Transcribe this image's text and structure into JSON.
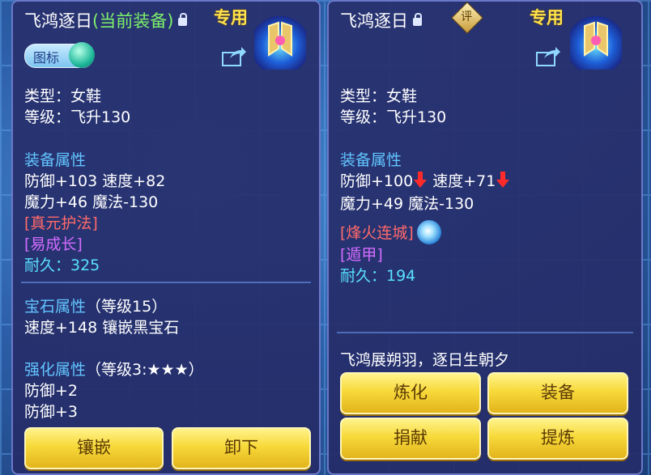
{
  "left": {
    "title": "飞鸿逐日",
    "title_current": "(当前装备)",
    "exclusive": "专用",
    "tag_label": "图标",
    "type": "类型：女鞋",
    "level": "等级：飞升130",
    "attr_header": "装备属性",
    "attr_line1": "防御+103 速度+82",
    "attr_line2": "魔力+46 魔法-130",
    "special": "[真元护法]",
    "effect": "[易成长]",
    "durability": "耐久：325",
    "gem_header": "宝石属性",
    "gem_level": "（等级15）",
    "gem_line": "速度+148 镶嵌黑宝石",
    "enhance_header": "强化属性",
    "enhance_level": "（等级3:★★★）",
    "enhance_line1": "防御+2",
    "enhance_line2": "防御+3",
    "btn_inlay": "镶嵌",
    "btn_unequip": "卸下"
  },
  "right": {
    "title": "飞鸿逐日",
    "rating_label": "评",
    "exclusive": "专用",
    "type": "类型：女鞋",
    "level": "等级：飞升130",
    "attr_header": "装备属性",
    "attr_def": "防御+100",
    "attr_spd": "速度+71",
    "attr_line2": "魔力+49 魔法-130",
    "special": "[烽火连城]",
    "effect": "[遁甲]",
    "durability": "耐久：194",
    "flavor": "飞鸿展朔羽，逐日生朝夕",
    "btn_refine": "炼化",
    "btn_equip": "装备",
    "btn_donate": "捐献",
    "btn_extract": "提炼"
  },
  "colors": {
    "green": "#7df06a",
    "section": "#62c5ff",
    "red": "#ff6a6a",
    "purple": "#d36cff",
    "cyan": "#59e0ff",
    "gold": "#ffe24a",
    "button": "#f7d93a"
  },
  "icons": [
    "lock-icon",
    "share-icon",
    "down-arrow-icon",
    "rating-icon",
    "skill-icon",
    "boots-item-icon"
  ]
}
